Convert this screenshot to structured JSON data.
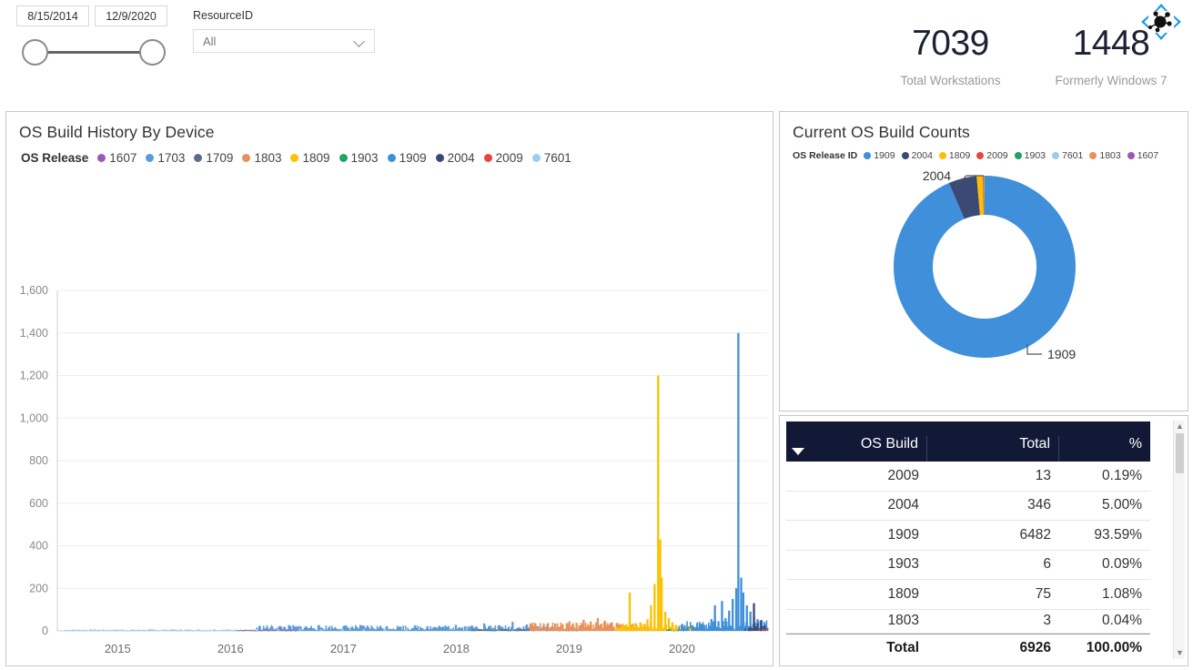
{
  "filters": {
    "date_slicer": {
      "start_date": "8/15/2014",
      "end_date": "12/9/2020"
    },
    "resource_slicer": {
      "label": "ResourceID",
      "value": "All",
      "icon": "chevron-down-icon"
    }
  },
  "kpis": [
    {
      "value": "7039",
      "label": "Total Workstations"
    },
    {
      "value": "1448",
      "label": "Formerly Windows 7"
    }
  ],
  "cursor": {
    "icon": "move-cursor-icon"
  },
  "history_panel": {
    "title": "OS Build History By Device",
    "legend_title": "OS Release"
  },
  "donut_panel": {
    "title": "Current OS Build Counts",
    "legend_title": "OS Release ID",
    "callouts": {
      "top": "2004",
      "bottom": "1909"
    }
  },
  "table": {
    "columns": [
      "OS Build",
      "Total",
      "%"
    ],
    "rows": [
      {
        "build": "2009",
        "total": "13",
        "pct": "0.19%"
      },
      {
        "build": "2004",
        "total": "346",
        "pct": "5.00%"
      },
      {
        "build": "1909",
        "total": "6482",
        "pct": "93.59%"
      },
      {
        "build": "1903",
        "total": "6",
        "pct": "0.09%"
      },
      {
        "build": "1809",
        "total": "75",
        "pct": "1.08%"
      },
      {
        "build": "1803",
        "total": "3",
        "pct": "0.04%"
      }
    ],
    "total_row": {
      "build": "Total",
      "total": "6926",
      "pct": "100.00%"
    },
    "sort_icon": "sort-descending-icon",
    "scrollbar": {
      "up_icon": "caret-up-icon",
      "down_icon": "caret-down-icon"
    }
  },
  "colors": {
    "1607": "#9B59B6",
    "1703": "#5B9BD5",
    "1709": "#5B6B8C",
    "1803": "#E8915A",
    "1809": "#FFC000",
    "1903": "#21A366",
    "1909": "#3F8FDB",
    "2004": "#3B4A75",
    "2009": "#E8453C",
    "7601": "#9DCCF0",
    "table_header_bg": "#111936",
    "panel_border": "#c8c8c8",
    "kpi_value": "#1a2233",
    "kpi_label": "#999999"
  },
  "chart_data": {
    "type": "bar",
    "title": "OS Build History By Device",
    "xlabel": "",
    "ylabel": "",
    "xlim": [
      "2014-08-15",
      "2020-12-09"
    ],
    "ylim": [
      0,
      1600
    ],
    "ytick_labels": [
      "0",
      "200",
      "400",
      "600",
      "800",
      "1,000",
      "1,200",
      "1,400",
      "1,600"
    ],
    "ytick_values": [
      0,
      200,
      400,
      600,
      800,
      1000,
      1200,
      1400,
      1600
    ],
    "xtick_labels": [
      "2015",
      "2016",
      "2017",
      "2018",
      "2019",
      "2020"
    ],
    "grid": "horizontal",
    "legend_position": "top",
    "legend_entries": [
      "1607",
      "1703",
      "1709",
      "1803",
      "1809",
      "1903",
      "1909",
      "2004",
      "2009",
      "7601"
    ],
    "notes": "Stacked daily column chart of device OS build installs. Peaks: 1809 (yellow) spike ~1200 mid-2019; 1909 (blue) spike ~1400 mid-2020.",
    "series": [
      {
        "name": "7601",
        "color": "#9DCCF0",
        "points": [
          [
            0.02,
            4
          ],
          [
            0.05,
            6
          ],
          [
            0.08,
            3
          ],
          [
            0.12,
            5
          ],
          [
            0.16,
            7
          ],
          [
            0.19,
            4
          ],
          [
            0.22,
            8
          ],
          [
            0.25,
            5
          ],
          [
            0.28,
            9
          ],
          [
            0.31,
            6
          ],
          [
            0.34,
            11
          ],
          [
            0.37,
            7
          ],
          [
            0.4,
            12
          ],
          [
            0.43,
            8
          ],
          [
            0.46,
            10
          ],
          [
            0.49,
            6
          ]
        ]
      },
      {
        "name": "1703",
        "color": "#5B9BD5",
        "points": [
          [
            0.3,
            5
          ],
          [
            0.33,
            8
          ],
          [
            0.36,
            12
          ],
          [
            0.39,
            9
          ],
          [
            0.42,
            15
          ],
          [
            0.45,
            11
          ],
          [
            0.48,
            18
          ],
          [
            0.5,
            14
          ],
          [
            0.52,
            22
          ],
          [
            0.54,
            17
          ],
          [
            0.56,
            28
          ],
          [
            0.58,
            20
          ],
          [
            0.6,
            35
          ],
          [
            0.62,
            24
          ],
          [
            0.64,
            42
          ],
          [
            0.66,
            30
          ]
        ]
      },
      {
        "name": "1709",
        "color": "#5B6B8C",
        "points": [
          [
            0.6,
            6
          ],
          [
            0.63,
            9
          ],
          [
            0.66,
            7
          ],
          [
            0.69,
            11
          ],
          [
            0.72,
            8
          ]
        ]
      },
      {
        "name": "1803",
        "color": "#E8915A",
        "points": [
          [
            0.67,
            12
          ],
          [
            0.69,
            22
          ],
          [
            0.7,
            35
          ],
          [
            0.71,
            28
          ],
          [
            0.72,
            45
          ],
          [
            0.73,
            38
          ],
          [
            0.74,
            52
          ],
          [
            0.75,
            44
          ],
          [
            0.76,
            60
          ],
          [
            0.77,
            48
          ],
          [
            0.78,
            40
          ],
          [
            0.79,
            30
          ],
          [
            0.8,
            25
          ],
          [
            0.81,
            18
          ],
          [
            0.82,
            14
          ]
        ]
      },
      {
        "name": "1809",
        "color": "#FFC000",
        "points": [
          [
            0.79,
            15
          ],
          [
            0.8,
            28
          ],
          [
            0.805,
            180
          ],
          [
            0.81,
            35
          ],
          [
            0.815,
            22
          ],
          [
            0.82,
            40
          ],
          [
            0.825,
            30
          ],
          [
            0.83,
            55
          ],
          [
            0.835,
            120
          ],
          [
            0.84,
            220
          ],
          [
            0.845,
            1200
          ],
          [
            0.848,
            430
          ],
          [
            0.85,
            250
          ],
          [
            0.855,
            90
          ],
          [
            0.86,
            60
          ],
          [
            0.865,
            40
          ],
          [
            0.87,
            28
          ],
          [
            0.88,
            20
          ],
          [
            0.89,
            14
          ],
          [
            0.9,
            10
          ]
        ]
      },
      {
        "name": "1903",
        "color": "#21A366",
        "points": [
          [
            0.86,
            8
          ],
          [
            0.88,
            12
          ],
          [
            0.9,
            9
          ],
          [
            0.92,
            7
          ],
          [
            0.94,
            5
          ]
        ]
      },
      {
        "name": "1909",
        "color": "#3F8FDB",
        "points": [
          [
            0.88,
            20
          ],
          [
            0.9,
            35
          ],
          [
            0.91,
            28
          ],
          [
            0.92,
            55
          ],
          [
            0.925,
            120
          ],
          [
            0.93,
            45
          ],
          [
            0.935,
            140
          ],
          [
            0.94,
            60
          ],
          [
            0.945,
            95
          ],
          [
            0.95,
            150
          ],
          [
            0.955,
            200
          ],
          [
            0.958,
            1400
          ],
          [
            0.962,
            250
          ],
          [
            0.965,
            180
          ],
          [
            0.97,
            120
          ],
          [
            0.975,
            90
          ],
          [
            0.98,
            70
          ],
          [
            0.985,
            55
          ],
          [
            0.99,
            45
          ],
          [
            0.995,
            35
          ]
        ]
      },
      {
        "name": "2004",
        "color": "#3B4A75",
        "points": [
          [
            0.975,
            20
          ],
          [
            0.98,
            130
          ],
          [
            0.985,
            35
          ],
          [
            0.99,
            50
          ],
          [
            0.995,
            25
          ]
        ]
      },
      {
        "name": "2009",
        "color": "#E8453C",
        "points": [
          [
            0.993,
            8
          ],
          [
            0.997,
            6
          ]
        ]
      },
      {
        "name": "1607",
        "color": "#9B59B6",
        "points": [
          [
            0.26,
            3
          ],
          [
            0.29,
            4
          ],
          [
            0.32,
            3
          ]
        ]
      }
    ]
  },
  "donut_data": {
    "type": "pie",
    "title": "Current OS Build Counts",
    "labels": [
      "1909",
      "2004",
      "1809",
      "2009",
      "1903",
      "1803"
    ],
    "values": [
      6482,
      346,
      75,
      13,
      6,
      3
    ],
    "percentages": [
      93.59,
      5.0,
      1.08,
      0.19,
      0.09,
      0.04
    ],
    "colors": [
      "#3F8FDB",
      "#3B4A75",
      "#FFC000",
      "#E8453C",
      "#21A366",
      "#E8915A"
    ],
    "total": 6926,
    "hole_ratio": 0.57,
    "visible_callouts": [
      "2004",
      "1909"
    ]
  }
}
